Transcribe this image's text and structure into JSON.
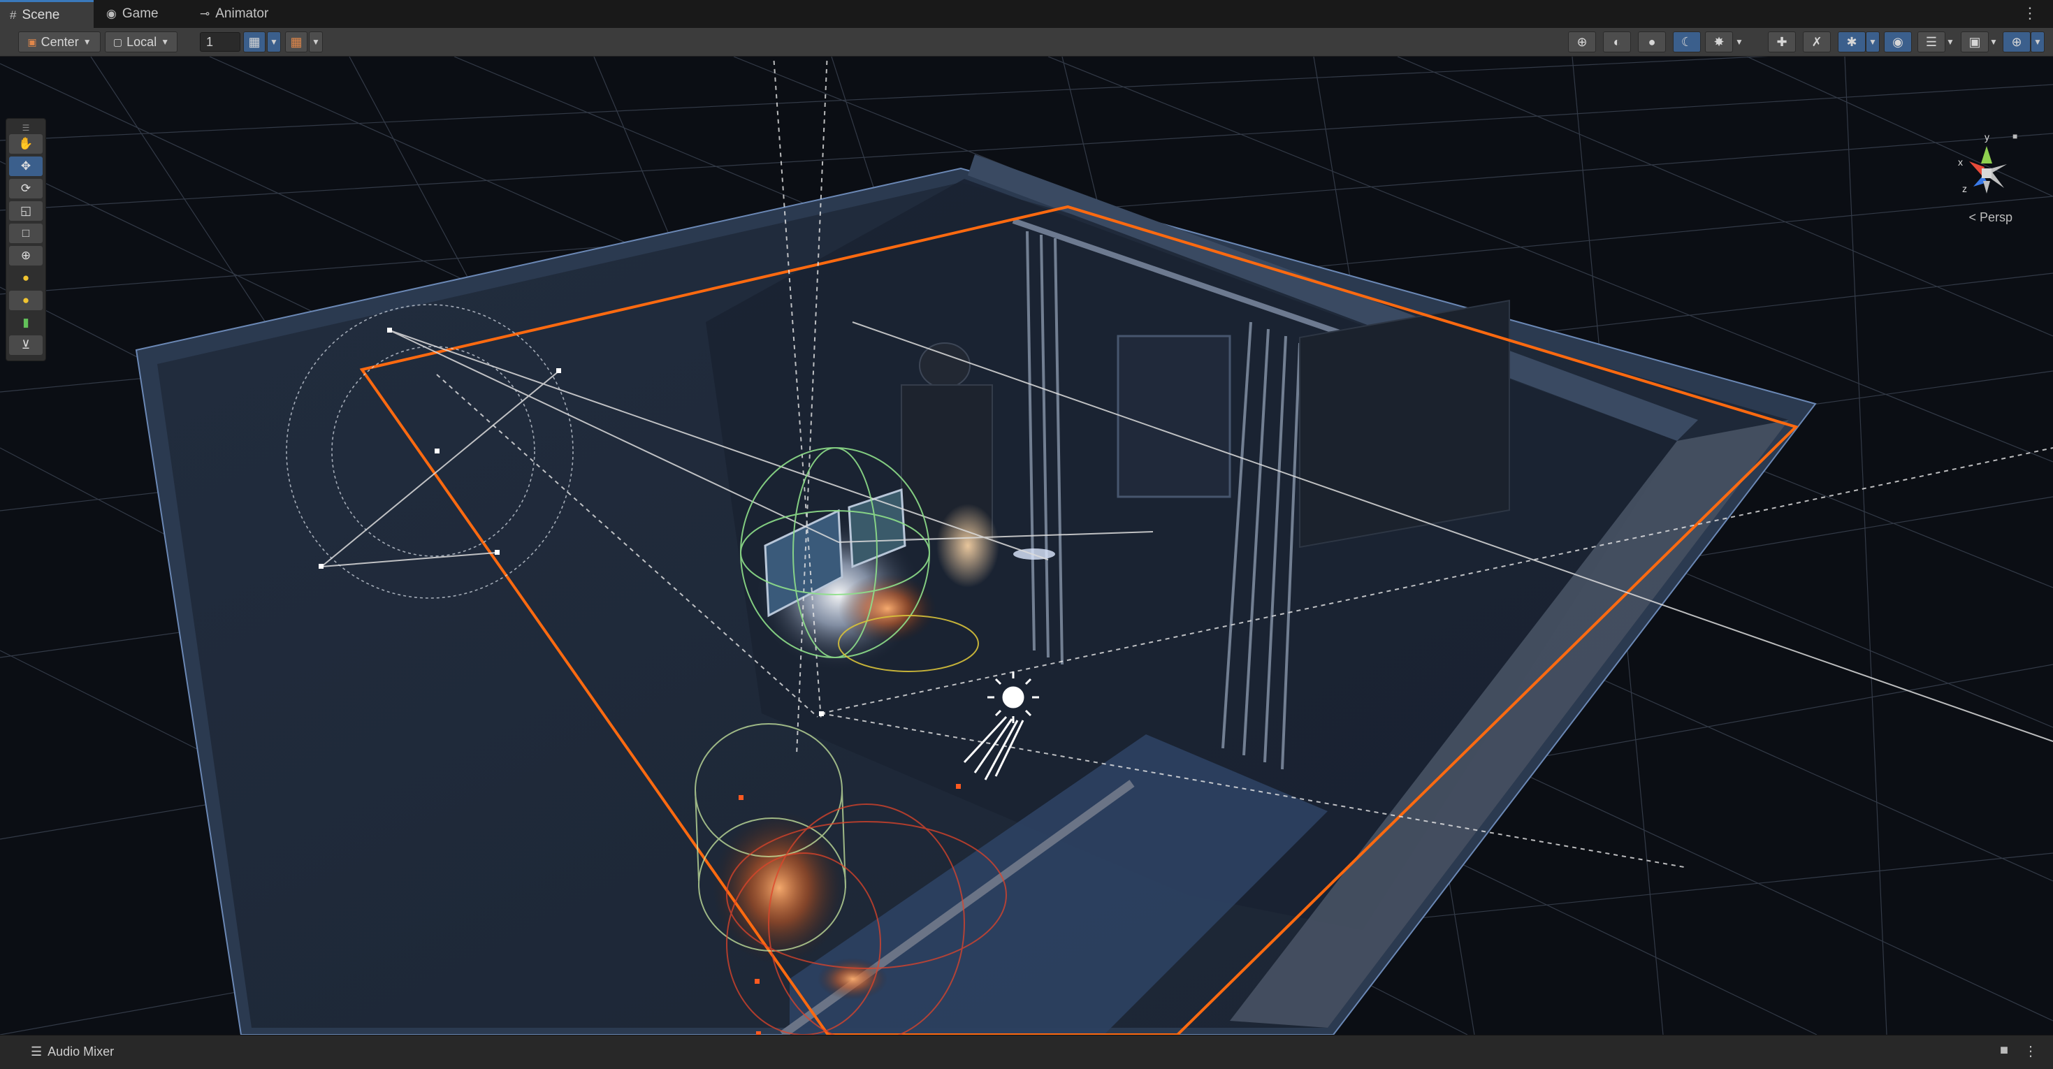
{
  "tabs": [
    {
      "label": "Scene",
      "icon": "grid-icon",
      "active": true
    },
    {
      "label": "Game",
      "icon": "gamepad-icon",
      "active": false
    },
    {
      "label": "Animator",
      "icon": "animator-icon",
      "active": false
    }
  ],
  "toolbar": {
    "pivot_label": "Center",
    "space_label": "Local",
    "snap_value": "1"
  },
  "left_tools": [
    {
      "name": "hand-tool",
      "icon": "hand-icon",
      "active": false
    },
    {
      "name": "move-tool",
      "icon": "move-icon",
      "active": true
    },
    {
      "name": "rotate-tool",
      "icon": "rotate-icon",
      "active": false
    },
    {
      "name": "scale-tool",
      "icon": "scale-icon",
      "active": false
    },
    {
      "name": "rect-tool",
      "icon": "rect-icon",
      "active": false
    },
    {
      "name": "transform-tool",
      "icon": "transform-icon",
      "active": false
    },
    {
      "name": "light-tool",
      "icon": "bulb-icon",
      "active": false
    },
    {
      "name": "light-probe-tool",
      "icon": "bulb-select-icon",
      "active": false
    },
    {
      "name": "capsule-tool",
      "icon": "capsule-icon",
      "active": false
    },
    {
      "name": "path-tool",
      "icon": "path-icon",
      "active": false
    }
  ],
  "bottom_tools": [
    {
      "name": "move",
      "icon": "move-icon",
      "active": true
    },
    {
      "name": "align",
      "icon": "align-icon",
      "active": false
    },
    {
      "name": "grid",
      "icon": "grid-icon",
      "active": false
    },
    {
      "name": "orbit",
      "icon": "orbit-icon",
      "active": false
    },
    {
      "name": "probe",
      "icon": "probe-icon",
      "active": false
    },
    {
      "name": "zoom",
      "icon": "zoom-icon",
      "active": false
    },
    {
      "name": "pan",
      "icon": "pan-icon",
      "active": true
    },
    {
      "name": "camera",
      "icon": "camera-icon",
      "active": false
    },
    {
      "name": "compass",
      "icon": "compass-icon",
      "active": false
    },
    {
      "name": "shuffle",
      "icon": "shuffle-icon",
      "active": false
    }
  ],
  "gizmo": {
    "x": "x",
    "y": "y",
    "z": "z",
    "mode": "< Persp"
  },
  "status": {
    "audio_mixer": "Audio Mixer"
  },
  "colors": {
    "accent": "#3b5f8c",
    "selection_outline": "#ff6a10",
    "viewport_bg": "#0b0e14"
  }
}
